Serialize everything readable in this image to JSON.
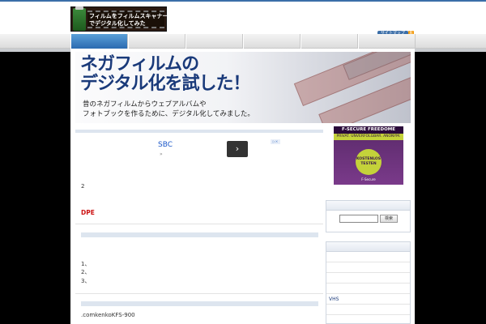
{
  "header": {
    "logo_line1": "フィルムをフィルムスキャナー",
    "logo_line2": "でデジタル化してみた",
    "sitemap_label": "サイトマップ",
    "rss_label": "R"
  },
  "nav": {
    "active_index": 0
  },
  "banner": {
    "title_line1": "ネガフィルムの",
    "title_line2": "デジタル化を試した！",
    "sub_line1": "昔のネガフィルムからウェブアルバムや",
    "sub_line2": "フォトブックを作るために、デジタル化してみました。"
  },
  "ad": {
    "title": "SBC",
    "sub": "»",
    "next_label": "›",
    "badge": "▷×"
  },
  "content": {
    "line_2": "2",
    "red_heading": "DPE",
    "list_1": "1、",
    "list_2": "2、",
    "list_3": "3、",
    "footer_text": ".comkenkoKFS-900"
  },
  "sidebar_ad": {
    "header": "F-SECURE FREEDOME",
    "sub": "PRIVAT. UNVERFOLGBAR. ANONYM.",
    "circle_line1": "KOSTENLOS",
    "circle_line2": "TESTEN",
    "brand": "F-Secure"
  },
  "search_widget": {
    "button_label": "検索"
  },
  "links_widget": {
    "items": [
      "",
      "",
      "",
      "",
      "VHS ",
      ""
    ]
  }
}
